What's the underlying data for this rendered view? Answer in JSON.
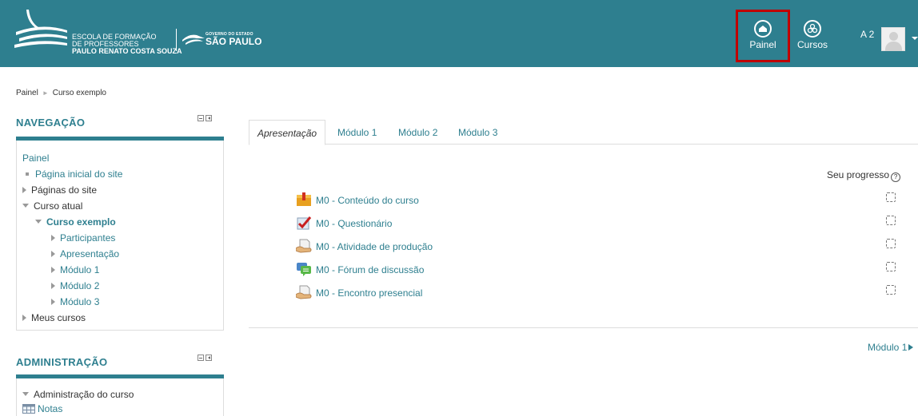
{
  "header": {
    "logo_line1": "ESCOLA DE FORMAÇÃO",
    "logo_line2": "DE PROFESSORES",
    "logo_line3": "PAULO RENATO COSTA SOUZA",
    "gov_small": "GOVERNO DO ESTADO",
    "gov_big": "SÃO PAULO",
    "painel_label": "Painel",
    "cursos_label": "Cursos",
    "user_initials": "A 2",
    "bg_color": "#2e7f8f"
  },
  "breadcrumb": {
    "items": [
      "Painel",
      "Curso exemplo"
    ],
    "separator": "►"
  },
  "navigation": {
    "title": "NAVEGAÇÃO",
    "root": "Painel",
    "items": {
      "home": "Página inicial do site",
      "site_pages": "Páginas do site",
      "current_course": "Curso atual",
      "course": "Curso exemplo",
      "participants": "Participantes",
      "intro": "Apresentação",
      "mod1": "Módulo 1",
      "mod2": "Módulo 2",
      "mod3": "Módulo 3",
      "my_courses": "Meus cursos"
    }
  },
  "administration": {
    "title": "ADMINISTRAÇÃO",
    "course_admin": "Administração do curso",
    "grades": "Notas"
  },
  "tabs": [
    "Apresentação",
    "Módulo 1",
    "Módulo 2",
    "Módulo 3"
  ],
  "progress_label": "Seu progresso",
  "activities": [
    {
      "label": "M0 - Conteúdo do curso",
      "icon": "book-icon",
      "done": false
    },
    {
      "label": "M0 - Questionário",
      "icon": "quiz-icon",
      "done": false
    },
    {
      "label": "M0 - Atividade de produção",
      "icon": "assignment-icon",
      "done": false
    },
    {
      "label": "M0 - Fórum de discussão",
      "icon": "forum-icon",
      "done": false
    },
    {
      "label": "M0 - Encontro presencial",
      "icon": "assignment-icon",
      "done": false
    }
  ],
  "next_link": "Módulo 1"
}
